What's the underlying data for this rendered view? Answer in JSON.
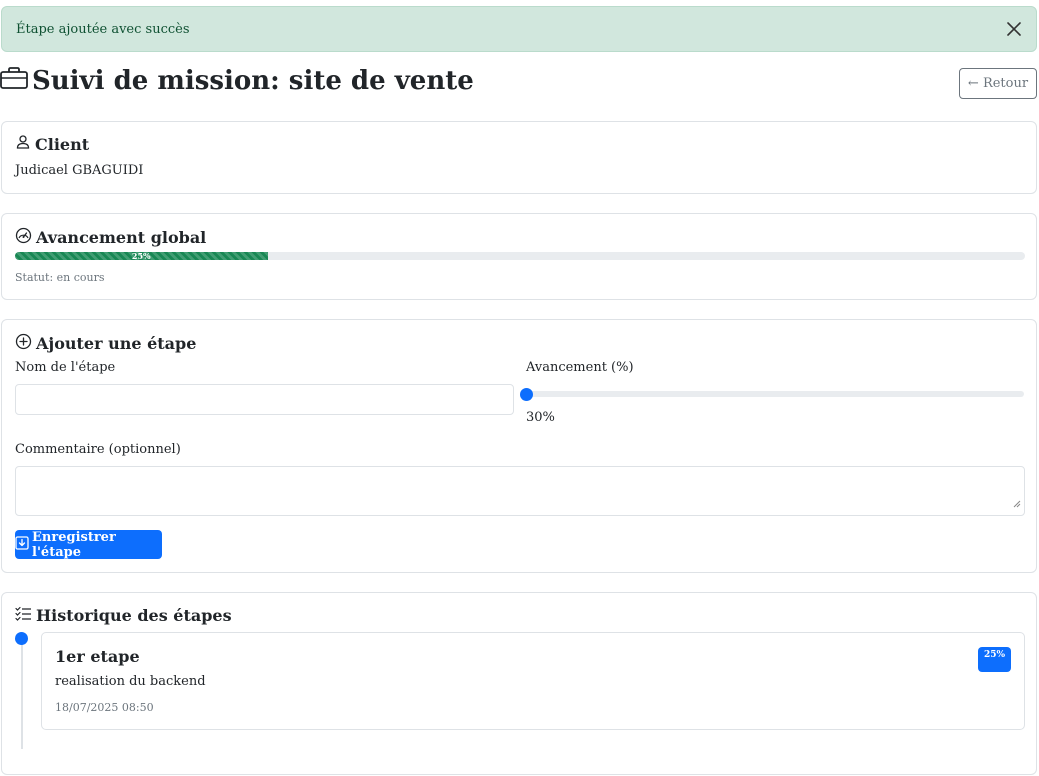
{
  "alert": {
    "message": "Étape ajoutée avec succès",
    "close_icon": "close-icon",
    "color": "#d1e7dd"
  },
  "page": {
    "title": "Suivi de mission: site de vente",
    "title_icon": "briefcase-icon",
    "back_label": "← Retour"
  },
  "client": {
    "heading": "Client",
    "icon": "person-icon",
    "name": "Judicael GBAGUIDI"
  },
  "progress": {
    "heading": "Avancement global",
    "icon": "speedometer-icon",
    "value": 25,
    "label": "25%",
    "status": "Statut: en cours",
    "bar_color": "#198754"
  },
  "form": {
    "heading": "Ajouter une étape",
    "icon": "plus-circle-icon",
    "name_label": "Nom de l'étape",
    "name_value": "",
    "progress_label": "Avancement (%)",
    "progress_value_display": "30%",
    "slider_fraction": 0,
    "comment_label": "Commentaire (optionnel)",
    "comment_value": "",
    "save_label": "Enregistrer l'étape",
    "save_icon": "download-icon",
    "accent": "#0d6efd"
  },
  "history": {
    "heading": "Historique des étapes",
    "icon": "list-check-icon",
    "steps": [
      {
        "name": "1er etape",
        "comment": "realisation du backend",
        "date": "18/07/2025 08:50",
        "badge": "25%"
      }
    ]
  }
}
